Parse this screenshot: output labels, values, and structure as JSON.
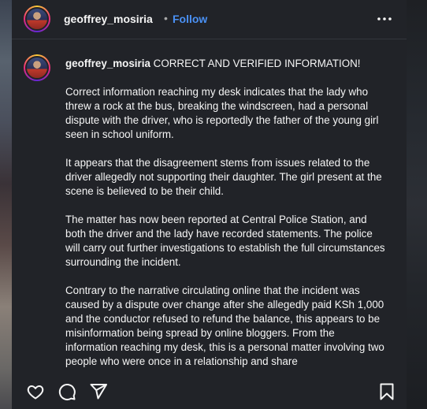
{
  "post": {
    "username": "geoffrey_mosiria",
    "separator": "•",
    "follow_label": "Follow",
    "caption": {
      "username": "geoffrey_mosiria",
      "headline": "CORRECT AND VERIFIED INFORMATION!",
      "paragraphs": [
        "Correct information reaching my desk indicates that the lady who threw a rock at the bus, breaking the windscreen, had a personal dispute with the driver, who is reportedly the father of the young girl seen in school uniform.",
        "It appears that the disagreement stems from issues related to the driver allegedly not supporting their daughter. The girl present at the scene is believed to be their child.",
        "The matter has now been reported at Central Police Station, and both the driver and the lady have recorded statements. The police will carry out further investigations to establish the full circumstances surrounding the incident.",
        "Contrary to the narrative circulating online that the incident was caused by a dispute over change after she allegedly paid KSh 1,000 and the conductor refused to refund the balance, this appears to be misinformation being spread by online bloggers. From the information reaching my desk, this is a personal matter involving two people who were once in a relationship and share"
      ]
    }
  },
  "icons": {
    "more": "more-options-icon",
    "like": "heart-icon",
    "comment": "comment-icon",
    "share": "share-icon",
    "save": "bookmark-icon"
  },
  "colors": {
    "background": "#212328",
    "text": "#f5f5f5",
    "follow": "#4a91f5"
  }
}
